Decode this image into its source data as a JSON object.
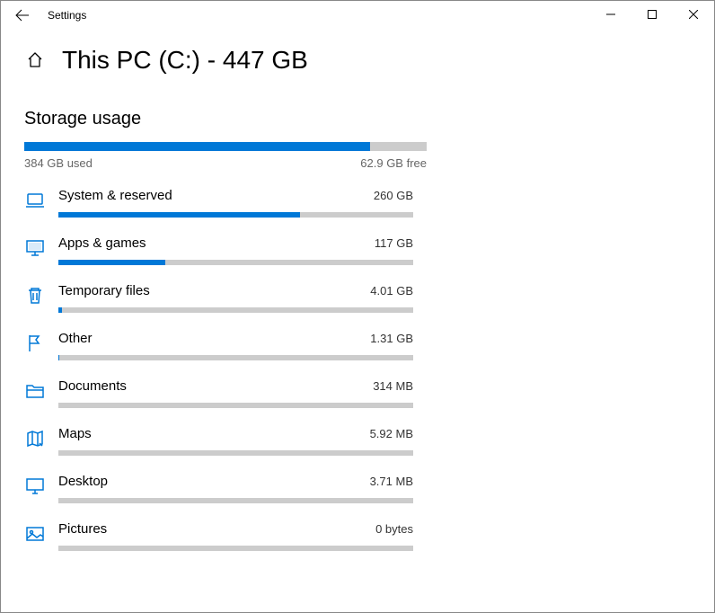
{
  "window": {
    "app_title": "Settings"
  },
  "page": {
    "title": "This PC (C:) - 447 GB",
    "section_heading": "Storage usage"
  },
  "overall": {
    "used_label": "384 GB used",
    "free_label": "62.9 GB free",
    "fill_percent": 86
  },
  "categories": [
    {
      "icon": "laptop-icon",
      "name": "System & reserved",
      "size": "260 GB",
      "fill_percent": 68
    },
    {
      "icon": "monitor-icon",
      "name": "Apps & games",
      "size": "117 GB",
      "fill_percent": 30
    },
    {
      "icon": "trash-icon",
      "name": "Temporary files",
      "size": "4.01 GB",
      "fill_percent": 1
    },
    {
      "icon": "flag-icon",
      "name": "Other",
      "size": "1.31 GB",
      "fill_percent": 0.3
    },
    {
      "icon": "folder-icon",
      "name": "Documents",
      "size": "314 MB",
      "fill_percent": 0
    },
    {
      "icon": "map-icon",
      "name": "Maps",
      "size": "5.92 MB",
      "fill_percent": 0
    },
    {
      "icon": "desktop-icon",
      "name": "Desktop",
      "size": "3.71 MB",
      "fill_percent": 0
    },
    {
      "icon": "picture-icon",
      "name": "Pictures",
      "size": "0 bytes",
      "fill_percent": 0
    }
  ]
}
